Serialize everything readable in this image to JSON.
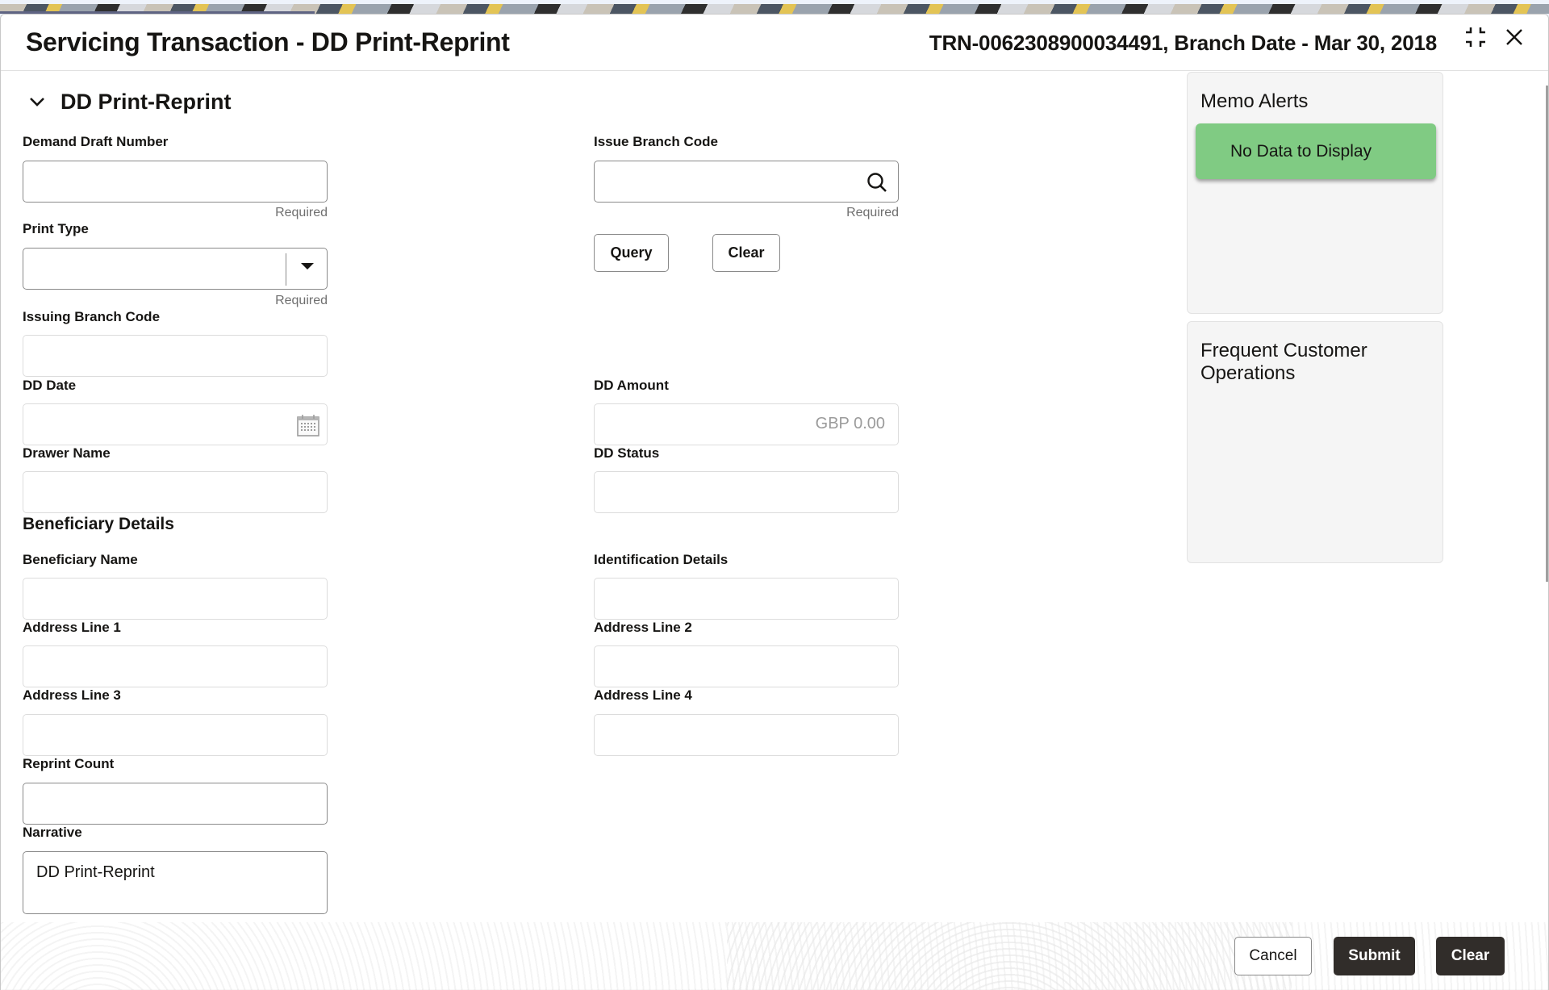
{
  "header": {
    "title": "Servicing Transaction - DD Print-Reprint",
    "meta": "TRN-0062308900034491, Branch Date - Mar 30, 2018",
    "minimize_icon": "collapse-arrows-icon",
    "close_icon": "close-icon"
  },
  "section": {
    "title": "DD Print-Reprint",
    "toggle_icon": "chevron-down-icon"
  },
  "form": {
    "demand_draft_number": {
      "label": "Demand Draft Number",
      "value": "",
      "required_text": "Required"
    },
    "issue_branch_code": {
      "label": "Issue Branch Code",
      "value": "",
      "required_text": "Required",
      "icon": "search-icon"
    },
    "print_type": {
      "label": "Print Type",
      "value": "",
      "required_text": "Required",
      "icon": "caret-down-icon"
    },
    "query_button": "Query",
    "clear_query_button": "Clear",
    "issuing_branch_code": {
      "label": "Issuing Branch Code",
      "value": ""
    },
    "dd_date": {
      "label": "DD Date",
      "value": "",
      "icon": "calendar-icon"
    },
    "dd_amount": {
      "label": "DD Amount",
      "value": "GBP 0.00"
    },
    "drawer_name": {
      "label": "Drawer Name",
      "value": ""
    },
    "dd_status": {
      "label": "DD Status",
      "value": ""
    },
    "beneficiary_heading": "Beneficiary Details",
    "beneficiary_name": {
      "label": "Beneficiary Name",
      "value": ""
    },
    "identification_details": {
      "label": "Identification Details",
      "value": ""
    },
    "address_line_1": {
      "label": "Address Line 1",
      "value": ""
    },
    "address_line_2": {
      "label": "Address Line 2",
      "value": ""
    },
    "address_line_3": {
      "label": "Address Line 3",
      "value": ""
    },
    "address_line_4": {
      "label": "Address Line 4",
      "value": ""
    },
    "reprint_count": {
      "label": "Reprint Count",
      "value": ""
    },
    "narrative": {
      "label": "Narrative",
      "value": "DD Print-Reprint"
    }
  },
  "side": {
    "memo_alerts": {
      "title": "Memo Alerts",
      "empty_text": "No Data to Display",
      "empty_color": "#80cb83"
    },
    "frequent_ops": {
      "title": "Frequent Customer Operations"
    }
  },
  "footer": {
    "cancel": "Cancel",
    "submit": "Submit",
    "clear": "Clear"
  }
}
